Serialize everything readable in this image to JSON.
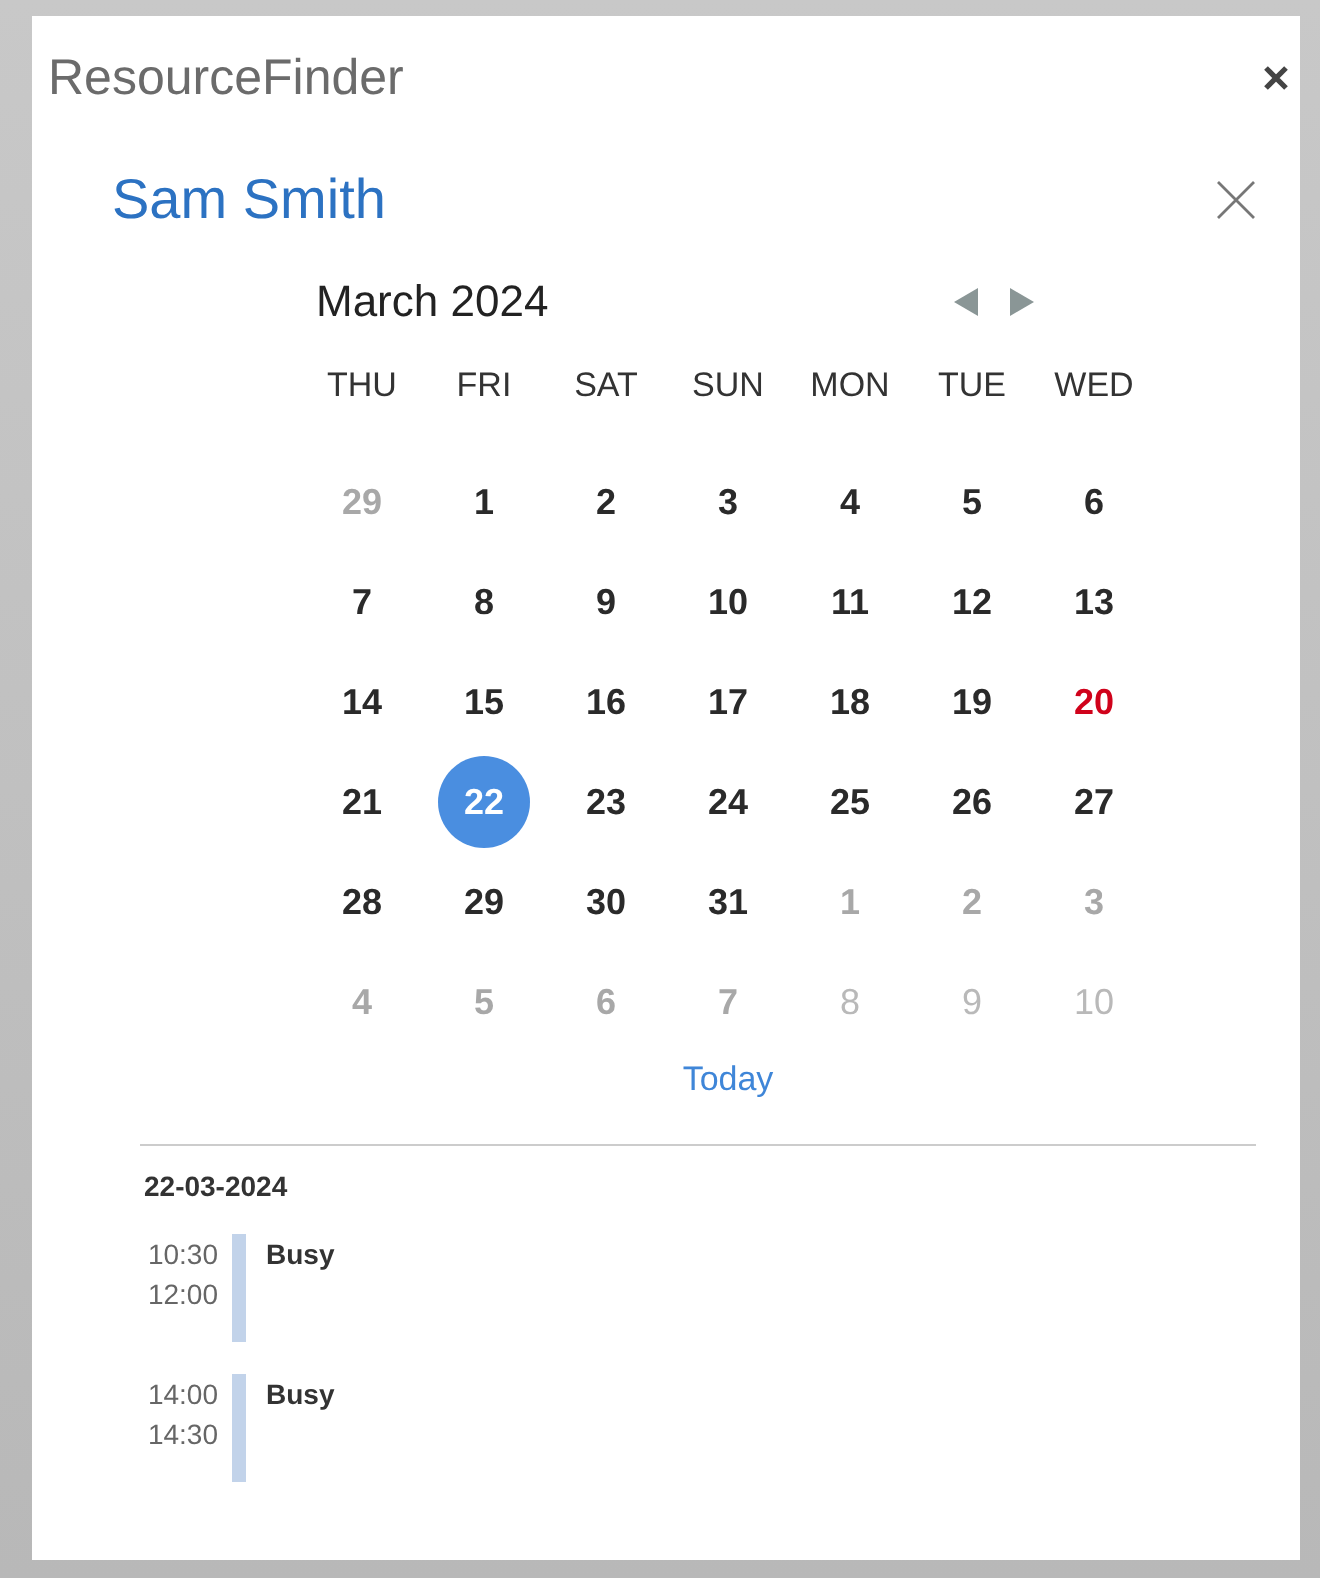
{
  "window": {
    "title": "ResourceFinder"
  },
  "person": {
    "name": "Sam Smith"
  },
  "calendar": {
    "month": "March 2024",
    "weekdays": [
      "THU",
      "FRI",
      "SAT",
      "SUN",
      "MON",
      "TUE",
      "WED"
    ],
    "weeks": [
      [
        {
          "day": "29",
          "kind": "adjacent",
          "selected": false,
          "disabled": false
        },
        {
          "day": "1",
          "kind": "month",
          "selected": false,
          "disabled": false
        },
        {
          "day": "2",
          "kind": "month",
          "selected": false,
          "disabled": false
        },
        {
          "day": "3",
          "kind": "month",
          "selected": false,
          "disabled": false
        },
        {
          "day": "4",
          "kind": "month",
          "selected": false,
          "disabled": false
        },
        {
          "day": "5",
          "kind": "month",
          "selected": false,
          "disabled": false
        },
        {
          "day": "6",
          "kind": "month",
          "selected": false,
          "disabled": false
        }
      ],
      [
        {
          "day": "7",
          "kind": "month",
          "selected": false,
          "disabled": false
        },
        {
          "day": "8",
          "kind": "month",
          "selected": false,
          "disabled": false
        },
        {
          "day": "9",
          "kind": "month",
          "selected": false,
          "disabled": false
        },
        {
          "day": "10",
          "kind": "month",
          "selected": false,
          "disabled": false
        },
        {
          "day": "11",
          "kind": "month",
          "selected": false,
          "disabled": false
        },
        {
          "day": "12",
          "kind": "month",
          "selected": false,
          "disabled": false
        },
        {
          "day": "13",
          "kind": "month",
          "selected": false,
          "disabled": false
        }
      ],
      [
        {
          "day": "14",
          "kind": "month",
          "selected": false,
          "disabled": false
        },
        {
          "day": "15",
          "kind": "month",
          "selected": false,
          "disabled": false
        },
        {
          "day": "16",
          "kind": "month",
          "selected": false,
          "disabled": false
        },
        {
          "day": "17",
          "kind": "month",
          "selected": false,
          "disabled": false
        },
        {
          "day": "18",
          "kind": "month",
          "selected": false,
          "disabled": false
        },
        {
          "day": "19",
          "kind": "month",
          "selected": false,
          "disabled": false
        },
        {
          "day": "20",
          "kind": "today",
          "selected": false,
          "disabled": false
        }
      ],
      [
        {
          "day": "21",
          "kind": "month",
          "selected": false,
          "disabled": false
        },
        {
          "day": "22",
          "kind": "month",
          "selected": true,
          "disabled": false
        },
        {
          "day": "23",
          "kind": "month",
          "selected": false,
          "disabled": false
        },
        {
          "day": "24",
          "kind": "month",
          "selected": false,
          "disabled": false
        },
        {
          "day": "25",
          "kind": "month",
          "selected": false,
          "disabled": false
        },
        {
          "day": "26",
          "kind": "month",
          "selected": false,
          "disabled": false
        },
        {
          "day": "27",
          "kind": "month",
          "selected": false,
          "disabled": false
        }
      ],
      [
        {
          "day": "28",
          "kind": "month",
          "selected": false,
          "disabled": false
        },
        {
          "day": "29",
          "kind": "month",
          "selected": false,
          "disabled": false
        },
        {
          "day": "30",
          "kind": "month",
          "selected": false,
          "disabled": false
        },
        {
          "day": "31",
          "kind": "month",
          "selected": false,
          "disabled": false
        },
        {
          "day": "1",
          "kind": "adjacent",
          "selected": false,
          "disabled": false
        },
        {
          "day": "2",
          "kind": "adjacent",
          "selected": false,
          "disabled": false
        },
        {
          "day": "3",
          "kind": "adjacent",
          "selected": false,
          "disabled": false
        }
      ],
      [
        {
          "day": "4",
          "kind": "adjacent",
          "selected": false,
          "disabled": false
        },
        {
          "day": "5",
          "kind": "adjacent",
          "selected": false,
          "disabled": false
        },
        {
          "day": "6",
          "kind": "adjacent",
          "selected": false,
          "disabled": false
        },
        {
          "day": "7",
          "kind": "adjacent",
          "selected": false,
          "disabled": false
        },
        {
          "day": "8",
          "kind": "adjacent",
          "selected": false,
          "disabled": true
        },
        {
          "day": "9",
          "kind": "adjacent",
          "selected": false,
          "disabled": true
        },
        {
          "day": "10",
          "kind": "adjacent",
          "selected": false,
          "disabled": true
        }
      ]
    ],
    "today_link": "Today"
  },
  "agenda": {
    "date": "22-03-2024",
    "events": [
      {
        "start": "10:30",
        "end": "12:00",
        "title": "Busy"
      },
      {
        "start": "14:00",
        "end": "14:30",
        "title": "Busy"
      }
    ]
  }
}
